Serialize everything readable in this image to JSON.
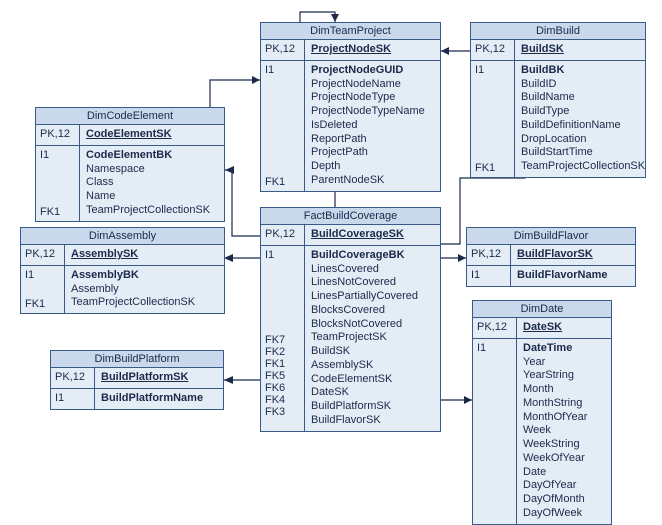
{
  "tables": {
    "dimTeamProject": {
      "title": "DimTeamProject",
      "pkLabel": "PK,12",
      "pkField": "ProjectNodeSK",
      "bodyLabel": "I1",
      "fk1Label": "FK1",
      "fields": [
        "ProjectNodeGUID",
        "ProjectNodeName",
        "ProjectNodeType",
        "ProjectNodeTypeName",
        "IsDeleted",
        "ReportPath",
        "ProjectPath",
        "Depth",
        "ParentNodeSK"
      ]
    },
    "dimBuild": {
      "title": "DimBuild",
      "pkLabel": "PK,12",
      "pkField": "BuildSK",
      "bodyLabel": "I1",
      "fk1Label": "FK1",
      "fields": [
        "BuildBK",
        "BuildID",
        "BuildName",
        "BuildType",
        "BuildDefinitionName",
        "DropLocation",
        "BuildStartTime",
        "TeamProjectCollectionSK"
      ]
    },
    "dimCodeElement": {
      "title": "DimCodeElement",
      "pkLabel": "PK,12",
      "pkField": "CodeElementSK",
      "bodyLabel": "I1",
      "fk1Label": "FK1",
      "fields": [
        "CodeElementBK",
        "Namespace",
        "Class",
        "Name",
        "TeamProjectCollectionSK"
      ]
    },
    "dimAssembly": {
      "title": "DimAssembly",
      "pkLabel": "PK,12",
      "pkField": "AssemblySK",
      "bodyLabel": "I1",
      "fk1Label": "FK1",
      "fields": [
        "AssemblyBK",
        "Assembly",
        "TeamProjectCollectionSK"
      ]
    },
    "dimBuildPlatform": {
      "title": "DimBuildPlatform",
      "pkLabel": "PK,12",
      "pkField": "BuildPlatformSK",
      "bodyLabel": "I1",
      "bodyField": "BuildPlatformName"
    },
    "factBuildCoverage": {
      "title": "FactBuildCoverage",
      "pkLabel": "PK,12",
      "pkField": "BuildCoverageSK",
      "bodyLabel": "I1",
      "fkLabels": [
        "FK7",
        "FK2",
        "FK1",
        "FK5",
        "FK6",
        "FK4",
        "FK3"
      ],
      "headerField": "BuildCoverageBK",
      "metricFields": [
        "LinesCovered",
        "LinesNotCovered",
        "LinesPartiallyCovered",
        "BlocksCovered",
        "BlocksNotCovered"
      ],
      "fkFields": [
        "TeamProjectSK",
        "BuildSK",
        "AssemblySK",
        "CodeElementSK",
        "DateSK",
        "BuildPlatformSK",
        "BuildFlavorSK"
      ]
    },
    "dimBuildFlavor": {
      "title": "DimBuildFlavor",
      "pkLabel": "PK,12",
      "pkField": "BuildFlavorSK",
      "bodyLabel": "I1",
      "bodyField": "BuildFlavorName"
    },
    "dimDate": {
      "title": "DimDate",
      "pkLabel": "PK,12",
      "pkField": "DateSK",
      "bodyLabel": "I1",
      "fields": [
        "DateTime",
        "Year",
        "YearString",
        "Month",
        "MonthString",
        "MonthOfYear",
        "Week",
        "WeekString",
        "WeekOfYear",
        "Date",
        "DayOfYear",
        "DayOfMonth",
        "DayOfWeek"
      ]
    }
  }
}
